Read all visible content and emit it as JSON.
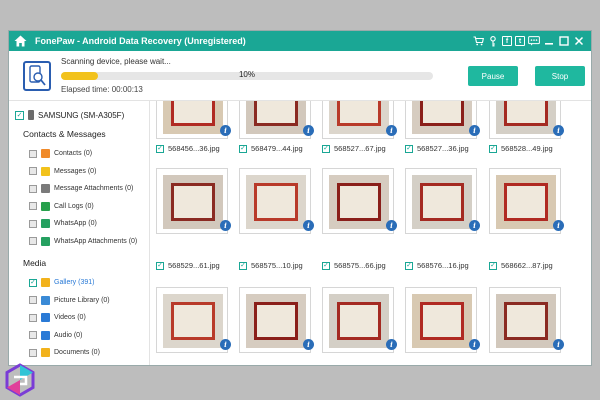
{
  "window": {
    "title": "FonePaw - Android Data Recovery (Unregistered)",
    "icons": [
      "home-icon",
      "cart-icon",
      "key-icon",
      "facebook-icon",
      "twitter-icon",
      "chat-icon",
      "minimize-icon",
      "maximize-icon",
      "close-icon"
    ],
    "facebook_glyph": "f",
    "twitter_glyph": "t"
  },
  "scan": {
    "status": "Scanning device, please wait...",
    "progress_label": "10%",
    "progress": 0.1,
    "elapsed": "Elapsed time: 00:00:13",
    "pause_label": "Pause",
    "stop_label": "Stop"
  },
  "sidebar": {
    "device": "SAMSUNG (SM-A305F)",
    "contacts_section": "Contacts & Messages",
    "contacts_items": [
      {
        "label": "Contacts (0)",
        "icon": "contacts-icon",
        "color": "#f08a2a"
      },
      {
        "label": "Messages (0)",
        "icon": "messages-icon",
        "color": "#f2c21c"
      },
      {
        "label": "Message Attachments (0)",
        "icon": "attachments-icon",
        "color": "#7a7a7a"
      },
      {
        "label": "Call Logs (0)",
        "icon": "call-logs-icon",
        "color": "#27a04c"
      },
      {
        "label": "WhatsApp (0)",
        "icon": "whatsapp-icon",
        "color": "#25a060"
      },
      {
        "label": "WhatsApp Attachments (0)",
        "icon": "whatsapp-attachments-icon",
        "color": "#25a060"
      }
    ],
    "media_section": "Media",
    "media_items": [
      {
        "label": "Gallery (391)",
        "icon": "gallery-icon",
        "color": "#f2b21c",
        "selected": true
      },
      {
        "label": "Picture Library (0)",
        "icon": "picture-library-icon",
        "color": "#3a8ad6"
      },
      {
        "label": "Videos (0)",
        "icon": "videos-icon",
        "color": "#2a7ad6"
      },
      {
        "label": "Audio (0)",
        "icon": "audio-icon",
        "color": "#2a7ad6"
      },
      {
        "label": "Documents (0)",
        "icon": "documents-icon",
        "color": "#f2b21c"
      }
    ]
  },
  "gallery": {
    "row1": [
      "568456...36.jpg",
      "568479...44.jpg",
      "568527...67.jpg",
      "568527...36.jpg",
      "568528...49.jpg"
    ],
    "row2": [
      "568529...61.jpg",
      "568575...10.jpg",
      "568575...66.jpg",
      "568576...16.jpg",
      "568662...87.jpg"
    ],
    "info_glyph": "i"
  },
  "colors": {
    "accent": "#1aa795",
    "button": "#1fb89f",
    "progress": "#f2c21c",
    "frame": "#9a2a22",
    "link": "#2a7ad6"
  }
}
